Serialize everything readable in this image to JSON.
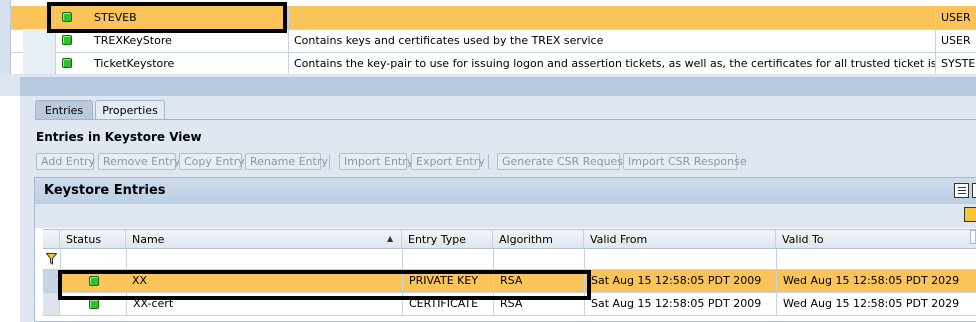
{
  "keystore_views": {
    "rows": [
      {
        "name": "STEVEB",
        "description": "",
        "type": "USER",
        "highlighted": true
      },
      {
        "name": "TREXKeyStore",
        "description": "Contains keys and certificates used by the TREX service",
        "type": "USER",
        "highlighted": false
      },
      {
        "name": "TicketKeystore",
        "description": "Contains the key-pair to use for issuing logon and assertion tickets, as well as, the certificates for all trusted ticket issuing systems",
        "type": "SYSTEM",
        "highlighted": false
      }
    ]
  },
  "tabs": [
    {
      "label": "Entries",
      "active": true
    },
    {
      "label": "Properties",
      "active": false
    }
  ],
  "section_title": "Entries in Keystore View",
  "toolbar": {
    "add_entry": "Add Entry",
    "remove_entry": "Remove Entry",
    "copy_entry": "Copy Entry",
    "rename_entry": "Rename Entry",
    "import_entry": "Import Entry",
    "export_entry": "Export Entry",
    "generate_csr": "Generate CSR Request",
    "import_csr_response": "Import CSR Response"
  },
  "entries_panel": {
    "title": "Keystore Entries",
    "columns": {
      "status": "Status",
      "name": "Name",
      "entry_type": "Entry Type",
      "algorithm": "Algorithm",
      "valid_from": "Valid From",
      "valid_to": "Valid To"
    },
    "sort_indicator": "▲",
    "rows": [
      {
        "name": "XX",
        "entry_type": "PRIVATE KEY",
        "algorithm": "RSA",
        "valid_from": "Sat Aug 15 12:58:05 PDT 2009",
        "valid_to": "Wed Aug 15 12:58:05 PDT 2029",
        "highlighted": true
      },
      {
        "name": "XX-cert",
        "entry_type": "CERTIFICATE",
        "algorithm": "RSA",
        "valid_from": "Sat Aug 15 12:58:05 PDT 2009",
        "valid_to": "Wed Aug 15 12:58:05 PDT 2029",
        "highlighted": false
      }
    ]
  },
  "icons": {
    "status": "green-status-icon",
    "filter": "filter-icon",
    "settings": "table-settings-icon"
  },
  "colors": {
    "selection_highlight": "#fac45a",
    "status_green": "#2fc22a",
    "header_blue": "#bccfe2"
  }
}
